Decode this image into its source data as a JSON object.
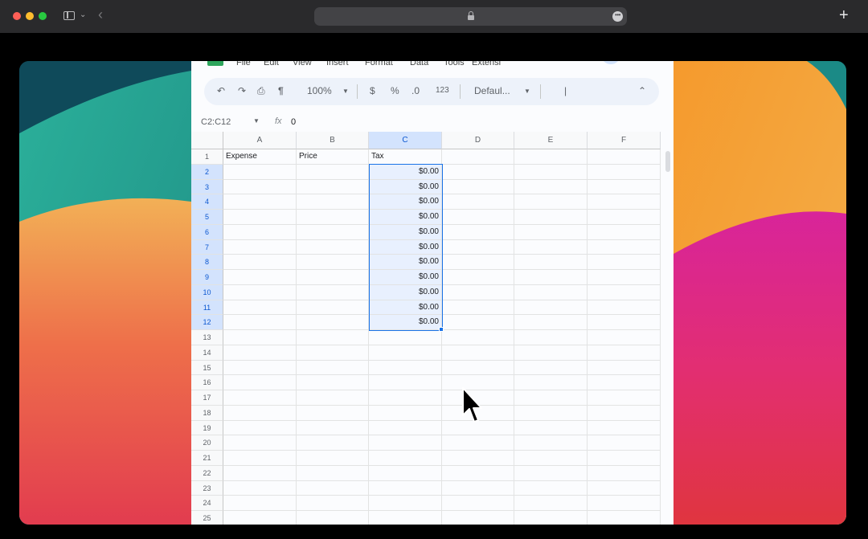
{
  "browser": {
    "traffic_lights": [
      "#fe5f57",
      "#febc2e",
      "#28c840"
    ],
    "new_tab": "+"
  },
  "sheets": {
    "menu": [
      "File",
      "Edit",
      "View",
      "Insert",
      "Format",
      "Data",
      "Tools",
      "Extensi"
    ],
    "toolbar": {
      "zoom": "100%",
      "currency": "$",
      "percent": "%",
      "number_format": "123",
      "font": "Defaul...",
      "size": "|"
    },
    "name_box": "C2:C12",
    "formula_value": "0",
    "columns": [
      "A",
      "B",
      "C",
      "D",
      "E",
      "F"
    ],
    "rows": [
      "1",
      "2",
      "3",
      "4",
      "5",
      "6",
      "7",
      "8",
      "9",
      "10",
      "11",
      "12",
      "13",
      "14",
      "15",
      "16",
      "17",
      "18",
      "19",
      "20",
      "21",
      "22",
      "23",
      "24",
      "25"
    ],
    "headers": {
      "a": "Expense",
      "b": "Price",
      "c": "Tax"
    },
    "tax_values": [
      "$0.00",
      "$0.00",
      "$0.00",
      "$0.00",
      "$0.00",
      "$0.00",
      "$0.00",
      "$0.00",
      "$0.00",
      "$0.00",
      "$0.00"
    ]
  }
}
